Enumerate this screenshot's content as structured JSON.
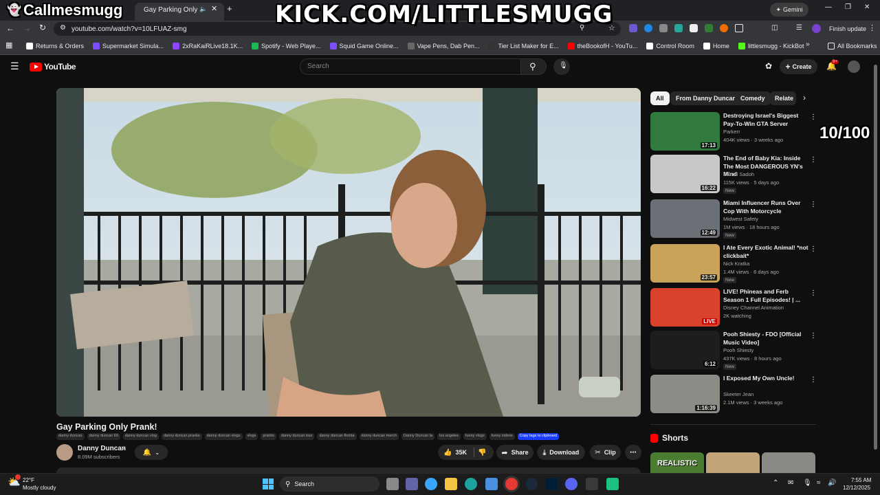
{
  "browser": {
    "tab_title": "Gay Parking Only Prank",
    "url": "youtube.com/watch?v=10LFUAZ-smg",
    "gemini_label": "Gemini",
    "finish_update_label": "Finish update",
    "all_bookmarks_label": "All Bookmarks",
    "bookmarks": [
      {
        "label": "Returns & Orders",
        "color": "#ffffff"
      },
      {
        "label": "Supermarket Simula...",
        "color": "#7c4dff"
      },
      {
        "label": "2xRaKaiRLive18.1K...",
        "color": "#9146ff"
      },
      {
        "label": "Spotify - Web Playe...",
        "color": "#1db954"
      },
      {
        "label": "Squid Game Online...",
        "color": "#7c4dff"
      },
      {
        "label": "Vape Pens, Dab Pen...",
        "color": "#666666"
      },
      {
        "label": "Tier List Maker for E...",
        "color": "#333333"
      },
      {
        "label": "theBookofH - YouTu...",
        "color": "#ff0000"
      },
      {
        "label": "Control Room",
        "color": "#ffffff"
      },
      {
        "label": "Home",
        "color": "#ffffff"
      },
      {
        "label": "littlesmugg - KickBot",
        "color": "#53fc18"
      }
    ]
  },
  "overlay": {
    "streamer_name": "Callmesmugg",
    "kick_url": "KICK.COM/LITTLESMUGG",
    "counter": "10/100"
  },
  "youtube": {
    "logo_text": "YouTube",
    "search_placeholder": "Search",
    "create_label": "Create",
    "notif_count": "9+",
    "video": {
      "title": "Gay Parking Only Prank!",
      "tags": [
        "danny duncan",
        "danny duncan 69",
        "danny duncan vlog",
        "danny duncan pranks",
        "danny duncan vlogs",
        "vlogs",
        "pranks",
        "danny duncan tour",
        "danny duncan florida",
        "danny duncan merch",
        "Danny Duncan la",
        "los angeles",
        "funny vlogs",
        "funny videos"
      ],
      "copy_tags_label": "Copy tags to clipboard",
      "channel": "Danny Duncan",
      "subscribers": "8.09M subscribers",
      "likes": "35K",
      "share_label": "Share",
      "download_label": "Download",
      "clip_label": "Clip"
    },
    "filters": [
      "All",
      "From Danny Duncan",
      "Comedy",
      "Relate"
    ],
    "recommendations": [
      {
        "title": "Destroying Israel's Biggest Pay-To-Win GTA Server",
        "channel": "Parkerr",
        "meta": "404K views · 3 weeks ago",
        "duration": "17:13",
        "new": "",
        "thumb": "#2f7a3c"
      },
      {
        "title": "The End of Baby Kia: Inside The Most DANGEROUS YN's Mind",
        "channel": "Daniel Sadoh",
        "meta": "115K views · 5 days ago",
        "duration": "16:22",
        "new": "New",
        "thumb": "#c8c8c8"
      },
      {
        "title": "Miami Influencer Runs Over Cop With Motorcycle",
        "channel": "Midwest Safety",
        "meta": "1M views · 18 hours ago",
        "duration": "12:49",
        "new": "New",
        "thumb": "#6a7076"
      },
      {
        "title": "I Ate Every Exotic Animal! *not clickbait*",
        "channel": "Nick Kratka",
        "meta": "1.4M views · 6 days ago",
        "duration": "23:57",
        "new": "New",
        "thumb": "#c9a35a"
      },
      {
        "title": "LIVE! Phineas and Ferb Season 1 Full Episodes! | ...",
        "channel": "Disney Channel Animation",
        "meta": "2K watching",
        "duration": "LIVE",
        "new": "",
        "thumb": "#d9432c"
      },
      {
        "title": "Pooh Shiesty - FDO [Official Music Video]",
        "channel": "Pooh Shiesty",
        "meta": "437K views · 8 hours ago",
        "duration": "6:12",
        "new": "New",
        "thumb": "#1d1d1d"
      },
      {
        "title": "I Exposed My Own Uncle!",
        "channel": "Skeeter Jean",
        "meta": "2.1M views · 3 weeks ago",
        "duration": "1:16:39",
        "new": "",
        "thumb": "#8c8c86"
      }
    ],
    "shorts_label": "Shorts",
    "shorts_thumb_text": "REALISTIC"
  },
  "taskbar": {
    "weather_temp": "22°F",
    "weather_desc": "Mostly cloudy",
    "search_label": "Search",
    "time": "7:55 AM",
    "date": "12/12/2025"
  }
}
